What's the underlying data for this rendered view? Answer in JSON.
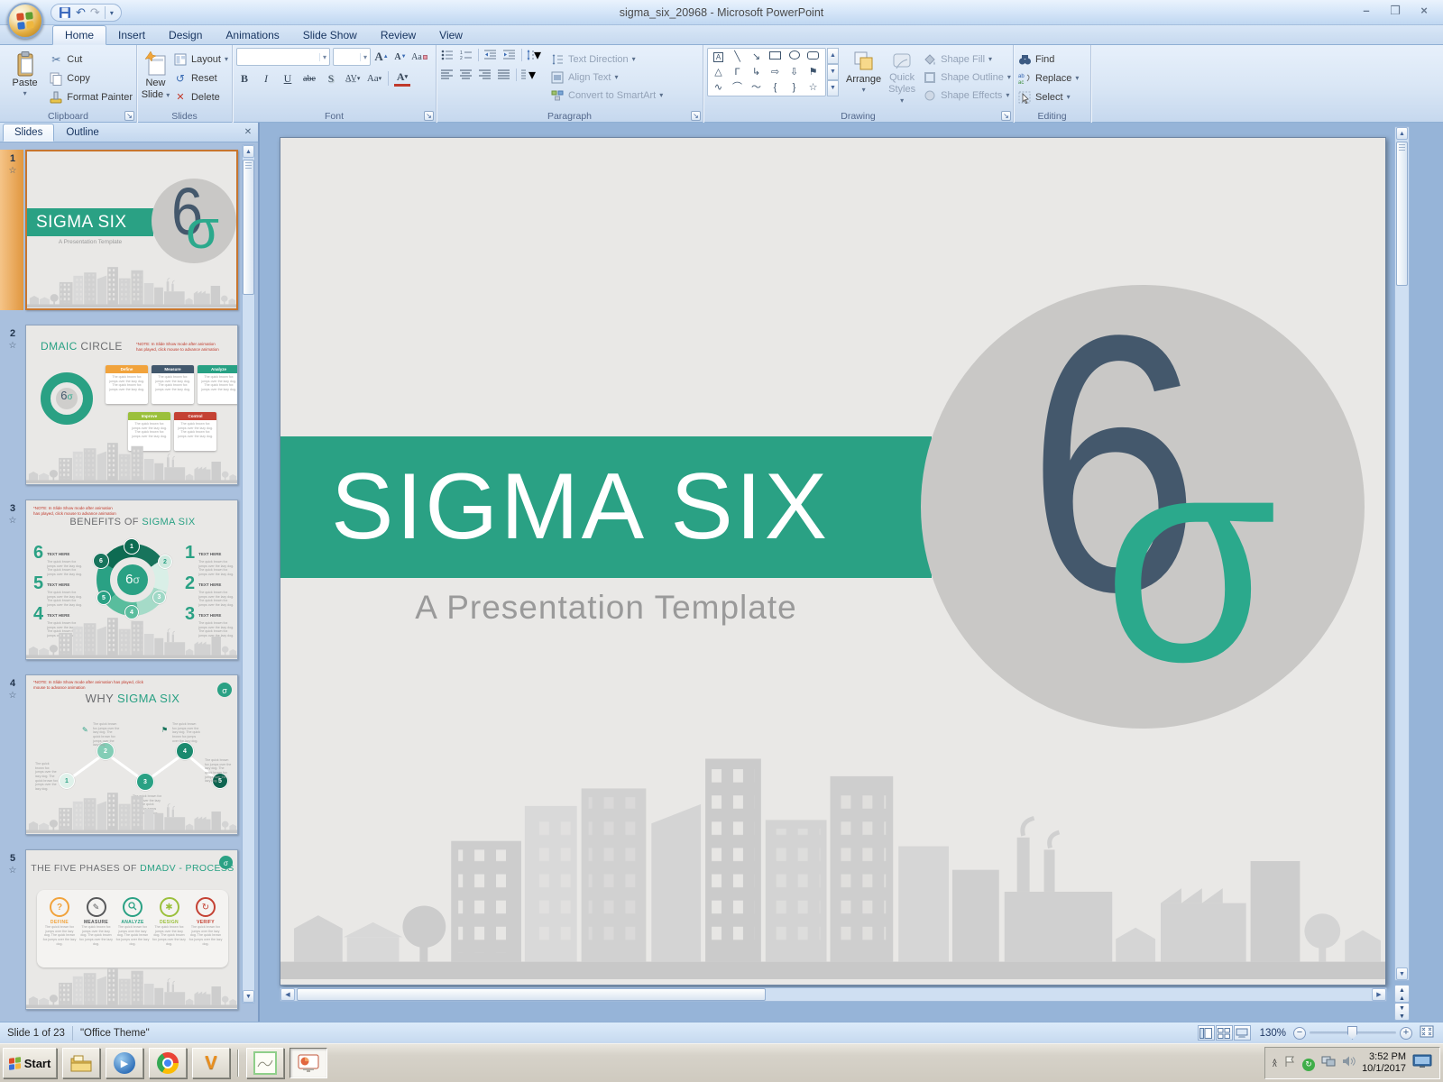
{
  "window": {
    "title": "sigma_six_20968 - Microsoft PowerPoint"
  },
  "ribbon": {
    "tabs": [
      "Home",
      "Insert",
      "Design",
      "Animations",
      "Slide Show",
      "Review",
      "View"
    ],
    "clipboard": {
      "label": "Clipboard",
      "paste": "Paste",
      "cut": "Cut",
      "copy": "Copy",
      "format_painter": "Format Painter"
    },
    "slides": {
      "label": "Slides",
      "new_slide_1": "New",
      "new_slide_2": "Slide",
      "layout": "Layout",
      "reset": "Reset",
      "delete": "Delete"
    },
    "font": {
      "label": "Font"
    },
    "paragraph": {
      "label": "Paragraph",
      "text_direction": "Text Direction",
      "align_text": "Align Text",
      "convert": "Convert to SmartArt"
    },
    "drawing": {
      "label": "Drawing",
      "arrange": "Arrange",
      "quick_styles_1": "Quick",
      "quick_styles_2": "Styles",
      "shape_fill": "Shape Fill",
      "shape_outline": "Shape Outline",
      "shape_effects": "Shape Effects"
    },
    "editing": {
      "label": "Editing",
      "find": "Find",
      "replace": "Replace",
      "select": "Select"
    }
  },
  "panel": {
    "tab_slides": "Slides",
    "tab_outline": "Outline"
  },
  "thumbs": {
    "note": "*NOTE: In Slide Show mode after animation has played, click mouse to advance animation",
    "lorem": "The quick brown fox jumps over the lazy dog. The quick brown fox jumps over the lazy dog.",
    "text_here": "TEXT HERE",
    "digits": [
      "1",
      "2",
      "3",
      "4",
      "5",
      "6"
    ],
    "s1": {
      "num": "1"
    },
    "s2": {
      "num": "2",
      "title_a": "DMAIC",
      "title_b": " CIRCLE",
      "c0": "Define",
      "c1": "Measure",
      "c2": "Analyze",
      "c3": "Improve",
      "c4": "Control",
      "ring_labels": "DEFINE MEASURE ANALYZE"
    },
    "s3": {
      "num": "3",
      "title_a": "BENEFITS  OF ",
      "title_b": "SIGMA  SIX"
    },
    "s4": {
      "num": "4",
      "title_a": "WHY ",
      "title_b": "SIGMA SIX"
    },
    "s5": {
      "num": "5",
      "title_a": "THE FIVE PHASES OF ",
      "title_b": "DMADV - PROCESS",
      "p0": "DEFINE",
      "p1": "MEASURE",
      "p2": "ANALYZE",
      "p3": "DESIGN",
      "p4": "VERIFY"
    }
  },
  "slide": {
    "title": "SIGMA SIX",
    "subtitle": "A Presentation Template",
    "six": "6",
    "sigma": "σ"
  },
  "status": {
    "slide_info": "Slide 1 of 23",
    "theme": "\"Office Theme\"",
    "zoom": "130%"
  },
  "taskbar": {
    "start": "Start",
    "time": "3:52 PM",
    "date": "10/1/2017"
  },
  "colors": {
    "teal": "#2AA184",
    "navy": "#44586C",
    "slide_bg": "#E9E8E6",
    "logo_circle": "#C9C8C6",
    "skyline": "#D2D2D2",
    "subtitle_gray": "#9A9A9A",
    "selection_orange": "#C7762E",
    "note_red": "#C0392B",
    "define_orange": "#F1A33C",
    "measure_navy": "#42586D",
    "analyze_teal": "#27A184",
    "improve_green": "#9BC03C",
    "control_red": "#C44133"
  }
}
